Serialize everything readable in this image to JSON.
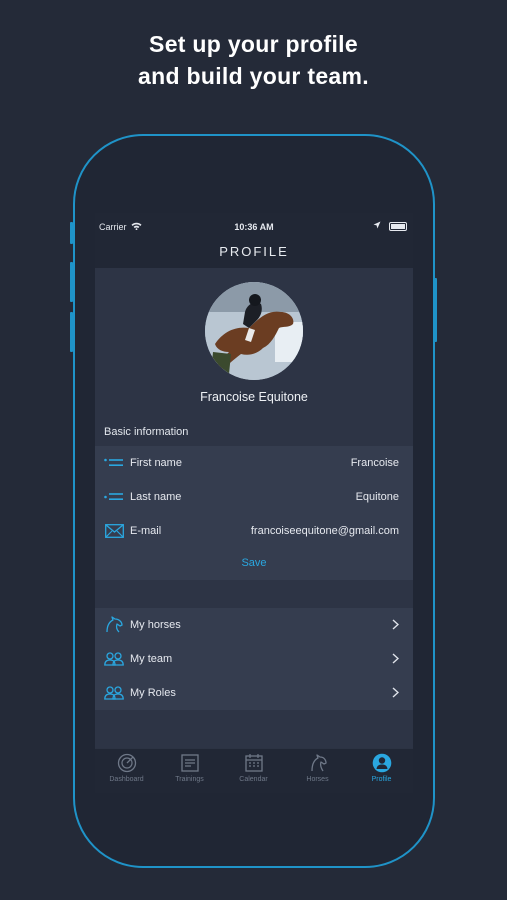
{
  "headline": {
    "line1": "Set up your profile",
    "line2": "and build your team."
  },
  "status_bar": {
    "carrier": "Carrier",
    "time": "10:36 AM"
  },
  "nav": {
    "title": "PROFILE"
  },
  "profile": {
    "name": "Francoise Equitone",
    "avatar_icon": "rider-photo-icon"
  },
  "basic_info": {
    "title": "Basic information",
    "fields": [
      {
        "label": "First name",
        "value": "Francoise",
        "icon": "list-icon"
      },
      {
        "label": "Last name",
        "value": "Equitone",
        "icon": "list-icon"
      },
      {
        "label": "E-mail",
        "value": "francoiseequitone@gmail.com",
        "icon": "envelope-icon"
      }
    ],
    "save_label": "Save"
  },
  "menu": [
    {
      "label": "My horses",
      "icon": "horse-icon"
    },
    {
      "label": "My team",
      "icon": "team-icon"
    },
    {
      "label": "My Roles",
      "icon": "roles-icon"
    }
  ],
  "tabs": [
    {
      "label": "Dashboard",
      "icon": "dashboard-icon"
    },
    {
      "label": "Trainings",
      "icon": "trainings-icon"
    },
    {
      "label": "Calendar",
      "icon": "calendar-icon"
    },
    {
      "label": "Horses",
      "icon": "horse-icon"
    },
    {
      "label": "Profile",
      "icon": "profile-icon",
      "active": true
    }
  ],
  "colors": {
    "accent": "#2aa7e0",
    "background": "#242a38",
    "panel": "#353d4f",
    "frame": "#1f93c8"
  }
}
